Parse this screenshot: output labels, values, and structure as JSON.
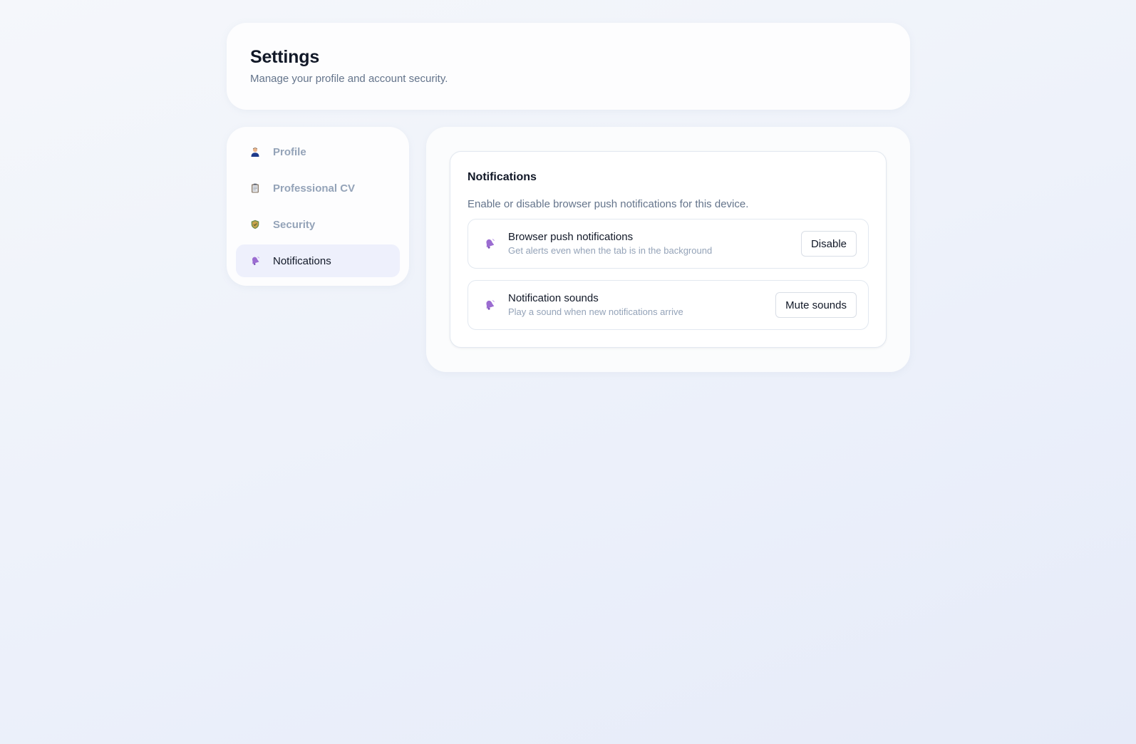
{
  "header": {
    "title": "Settings",
    "subtitle": "Manage your profile and account security."
  },
  "sidebar": {
    "items": [
      {
        "label": "Profile",
        "icon": "person-icon",
        "active": false
      },
      {
        "label": "Professional CV",
        "icon": "clipboard-icon",
        "active": false
      },
      {
        "label": "Security",
        "icon": "shield-icon",
        "active": false
      },
      {
        "label": "Notifications",
        "icon": "bell-icon",
        "active": true
      }
    ]
  },
  "panel": {
    "title": "Notifications",
    "description": "Enable or disable browser push notifications for this device.",
    "rows": [
      {
        "icon": "bell-icon",
        "title": "Browser push notifications",
        "subtitle": "Get alerts even when the tab is in the background",
        "button": "Disable"
      },
      {
        "icon": "bell-icon",
        "title": "Notification sounds",
        "subtitle": "Play a sound when new notifications arrive",
        "button": "Mute sounds"
      }
    ]
  },
  "colors": {
    "accent_active_bg": "#eef0fc",
    "bell_purple": "#8b5cc4",
    "muted_text": "#94a3b8"
  }
}
